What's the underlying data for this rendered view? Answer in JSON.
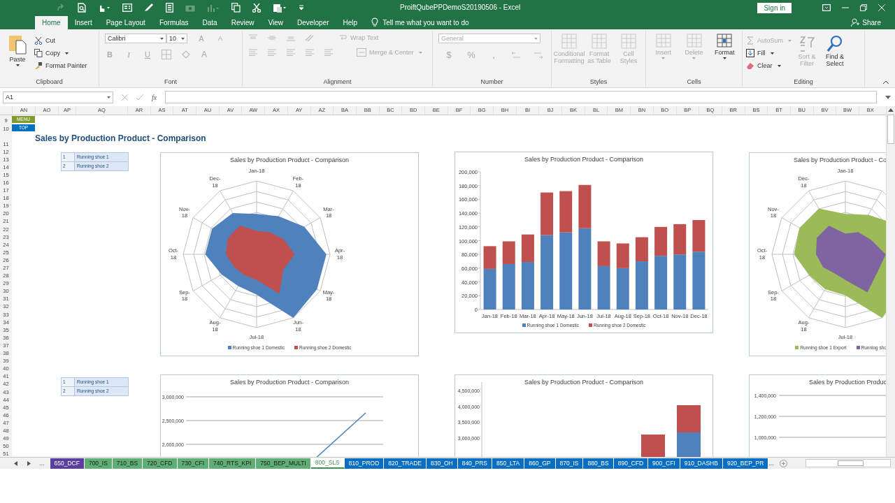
{
  "window": {
    "title": "ProiftQubePPDemoS20190506  -  Excel",
    "sign_in": "Sign in",
    "share": "Share"
  },
  "menu_tabs": [
    {
      "label": "Home",
      "selected": true
    },
    {
      "label": "Insert",
      "selected": false
    },
    {
      "label": "Page Layout",
      "selected": false
    },
    {
      "label": "Formulas",
      "selected": false
    },
    {
      "label": "Data",
      "selected": false
    },
    {
      "label": "Review",
      "selected": false
    },
    {
      "label": "View",
      "selected": false
    },
    {
      "label": "Developer",
      "selected": false
    },
    {
      "label": "Help",
      "selected": false
    }
  ],
  "tell_me": "Tell me what you want to do",
  "ribbon": {
    "groups": [
      {
        "kind": "clipboard",
        "label": "Clipboard",
        "paste": "Paste",
        "cut": "Cut",
        "copy": "Copy",
        "format_painter": "Format Painter"
      },
      {
        "kind": "font",
        "label": "Font",
        "disabled": true,
        "font_name": "Calibri",
        "font_size": "10",
        "styles": [
          "B",
          "I",
          "U"
        ],
        "sizes": [
          "A",
          "A"
        ],
        "color_letter": "A"
      },
      {
        "kind": "alignment",
        "label": "Alignment",
        "disabled": true,
        "wrap_text": "Wrap Text",
        "merge_center": "Merge & Center"
      },
      {
        "kind": "number",
        "label": "Number",
        "disabled": true,
        "format": "General",
        "symbols": [
          "$",
          "%",
          ","
        ]
      },
      {
        "kind": "styles",
        "label": "Styles",
        "disabled": true,
        "buttons": [
          "Conditional Formatting",
          "Format as Table",
          "Cell Styles"
        ]
      },
      {
        "kind": "cells",
        "label": "Cells",
        "buttons": [
          {
            "label": "Insert",
            "disabled": true
          },
          {
            "label": "Delete",
            "disabled": true
          },
          {
            "label": "Format",
            "disabled": false
          }
        ]
      },
      {
        "kind": "editing",
        "label": "Editing",
        "buttons": [
          {
            "label": "AutoSum",
            "disabled": true
          },
          {
            "label": "Fill",
            "disabled": false
          },
          {
            "label": "Clear",
            "disabled": false
          },
          {
            "label": "Sort & Filter",
            "disabled": true
          },
          {
            "label": "Find & Select",
            "disabled": false
          }
        ]
      }
    ]
  },
  "formula_bar": {
    "name_box": "A1",
    "fx": "fx"
  },
  "columns": [
    "AN",
    "AO",
    "AP",
    "AQ",
    "AR",
    "AS",
    "AT",
    "AU",
    "AV",
    "AW",
    "AX",
    "AY",
    "AZ",
    "BA",
    "BB",
    "BC",
    "BD",
    "BE",
    "BF",
    "BG",
    "BH",
    "BI",
    "BJ",
    "BK",
    "BL",
    "BM",
    "BN",
    "BO",
    "BP",
    "BQ",
    "BR",
    "BS",
    "BT",
    "BU",
    "BV",
    "BW",
    "BX"
  ],
  "rows": [
    "9",
    "10",
    "11",
    "12",
    "13",
    "14",
    "15",
    "16",
    "17",
    "18",
    "19",
    "20",
    "21",
    "22",
    "23",
    "24",
    "25",
    "26",
    "27",
    "28",
    "29",
    "30",
    "31",
    "32",
    "33",
    "34",
    "35",
    "36",
    "37",
    "38",
    "39",
    "40",
    "41",
    "42",
    "43",
    "44",
    "45",
    "46",
    "47",
    "48",
    "49",
    "50",
    "51"
  ],
  "nav_cells": [
    {
      "label": "MENU",
      "color": "#7f9b2e"
    },
    {
      "label": "TOP",
      "color": "#0070c0"
    }
  ],
  "sheet_title": "Sales by Production Product - Comparison",
  "selector_tables": [
    {
      "rows": [
        {
          "number": "1",
          "label": "Running shoe 1"
        },
        {
          "number": "2",
          "label": "Running shoe 2"
        }
      ]
    },
    {
      "rows": [
        {
          "number": "1",
          "label": "Running shoe 1"
        },
        {
          "number": "2",
          "label": "Running shoe 2"
        }
      ]
    }
  ],
  "charts": [
    {
      "kind": "radar",
      "title": "Sales by Production Product - Comparison",
      "cut_right": false,
      "axis_labels": [
        "Jan-18",
        "Feb-18",
        "Mar-18",
        "Apr-18",
        "May-18",
        "Jun-18",
        "Jul-18",
        "Aug-18",
        "Sep-18",
        "Oct-18",
        "Nov-18",
        "Dec-18"
      ],
      "legend": [
        {
          "label": "Running shoe 1 Domestic",
          "color": "#4f81bd"
        },
        {
          "label": "Running shoe 2 Domestic",
          "color": "#c0504d"
        }
      ]
    },
    {
      "kind": "bar",
      "cut_right": false,
      "chart_data": {
        "type": "bar",
        "title": "Sales by Production Product - Comparison",
        "stacked": true,
        "legend": "bottom",
        "categories": [
          "Jan-18",
          "Feb-18",
          "Mar-18",
          "Apr-18",
          "May-18",
          "Jun-18",
          "Jul-18",
          "Aug-18",
          "Sep-18",
          "Oct-18",
          "Nov-18",
          "Dec-18"
        ],
        "ylim": [
          0,
          200000
        ],
        "yticks": [
          {
            "value": 0,
            "label": "0"
          },
          {
            "value": 20000,
            "label": "20,000"
          },
          {
            "value": 40000,
            "label": "40,000"
          },
          {
            "value": 60000,
            "label": "60,000"
          },
          {
            "value": 80000,
            "label": "80,000"
          },
          {
            "value": 100000,
            "label": "100,000"
          },
          {
            "value": 120000,
            "label": "120,000"
          },
          {
            "value": 140000,
            "label": "140,000"
          },
          {
            "value": 160000,
            "label": "160,000"
          },
          {
            "value": 180000,
            "label": "180,000"
          },
          {
            "value": 200000,
            "label": "200,000"
          }
        ],
        "series": [
          {
            "name": "Running shoe 1 Domestic",
            "color": "#4f81bd",
            "values": [
              59000,
              66000,
              69000,
              108000,
              112000,
              118000,
              63000,
              60000,
              70000,
              78000,
              80000,
              84000
            ]
          },
          {
            "name": "Running shoe 2 Domestic",
            "color": "#c0504d",
            "values": [
              33000,
              33000,
              40000,
              62000,
              60000,
              63000,
              36000,
              36000,
              35000,
              42000,
              44000,
              46000
            ]
          }
        ]
      }
    },
    {
      "kind": "radar",
      "title": "Sales by Production Product - Co",
      "cut_right": true,
      "axis_labels": [
        "Jan-18",
        "Dec-18",
        "Nov-18",
        "Oct-18",
        "Sep-18",
        "Aug-18",
        "Jul-18"
      ],
      "legend": [
        {
          "label": "Running shoe 1 Export",
          "color": "#9bbb59"
        },
        {
          "label": "Running sho",
          "color": "#8064a2"
        }
      ]
    },
    {
      "kind": "line",
      "title": "Sales by Production Product - Comparison",
      "cut_right": false,
      "y_tick_labels": [
        "3,000,000",
        "2,500,000",
        "2,000,000"
      ],
      "series": [
        {
          "color": "#4f81bd"
        }
      ]
    },
    {
      "kind": "column",
      "title": "Sales by Production Product - Comparison",
      "cut_right": false,
      "y_tick_labels": [
        "4,500,000",
        "4,000,000",
        "3,500,000",
        "3,000,000"
      ],
      "series": [
        {
          "color": "#c0504d"
        },
        {
          "color": "#4f81bd"
        }
      ]
    },
    {
      "kind": "gridonly",
      "title": "Sales by Production Produc",
      "cut_right": true,
      "y_tick_labels": [
        "1,400,000",
        "1,200,000",
        "1,000,000"
      ]
    }
  ],
  "sheet_tabs": [
    {
      "label": "650_DCF",
      "color": "#5b3fa0",
      "selected": false
    },
    {
      "label": "700_IS",
      "color": "#5fae75",
      "selected": false
    },
    {
      "label": "710_BS",
      "color": "#5fae75",
      "selected": false
    },
    {
      "label": "720_CFD",
      "color": "#5fae75",
      "selected": false
    },
    {
      "label": "730_CFI",
      "color": "#5fae75",
      "selected": false
    },
    {
      "label": "740_RTS_KPI",
      "color": "#5fae75",
      "selected": false
    },
    {
      "label": "750_BEP_MULTI",
      "color": "#5fae75",
      "selected": false
    },
    {
      "label": "800_SLS",
      "color": "#3d8f55",
      "selected": true
    },
    {
      "label": "810_PROD",
      "color": "#0a6fc2",
      "selected": false
    },
    {
      "label": "820_TRADE",
      "color": "#0a6fc2",
      "selected": false
    },
    {
      "label": "830_OH",
      "color": "#0a6fc2",
      "selected": false
    },
    {
      "label": "840_PRS",
      "color": "#0a6fc2",
      "selected": false
    },
    {
      "label": "850_LTA",
      "color": "#0a6fc2",
      "selected": false
    },
    {
      "label": "860_GP",
      "color": "#0a6fc2",
      "selected": false
    },
    {
      "label": "870_IS",
      "color": "#0a6fc2",
      "selected": false
    },
    {
      "label": "880_BS",
      "color": "#0a6fc2",
      "selected": false
    },
    {
      "label": "890_CFD",
      "color": "#0a6fc2",
      "selected": false
    },
    {
      "label": "900_CFI",
      "color": "#0a6fc2",
      "selected": false
    },
    {
      "label": "910_DASHB",
      "color": "#0a6fc2",
      "selected": false
    },
    {
      "label": "920_BEP_PR",
      "color": "#0a6fc2",
      "selected": false
    }
  ],
  "tab_nav": {
    "more_left": "...",
    "more_right": "..."
  }
}
